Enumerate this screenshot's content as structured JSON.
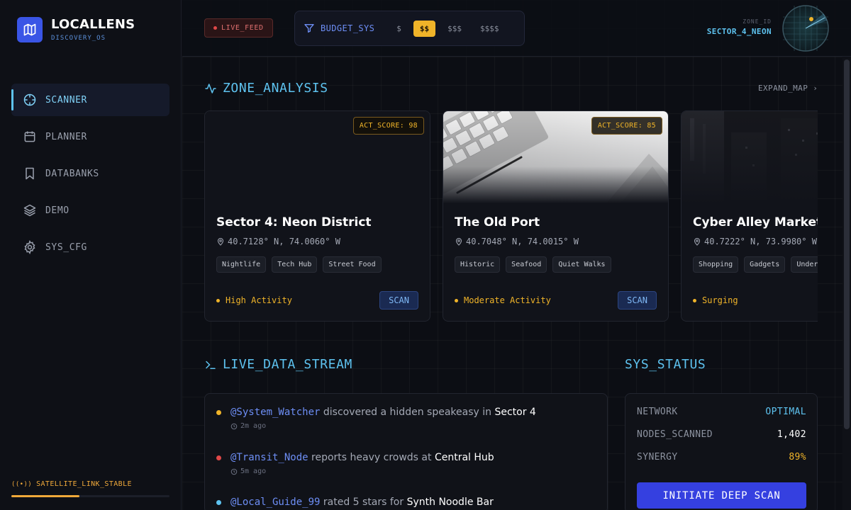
{
  "brand": {
    "name": "LOCALLENS",
    "subtitle": "DISCOVERY_OS"
  },
  "sidebar": {
    "items": [
      {
        "label": "SCANNER",
        "icon": "crosshair-icon",
        "active": true
      },
      {
        "label": "PLANNER",
        "icon": "calendar-icon",
        "active": false
      },
      {
        "label": "DATABANKS",
        "icon": "bookmark-icon",
        "active": false
      },
      {
        "label": "DEMO",
        "icon": "layers-icon",
        "active": false
      },
      {
        "label": "SYS_CFG",
        "icon": "gear-icon",
        "active": false
      }
    ],
    "satellite": {
      "label": "SATELLITE_LINK_STABLE",
      "progress": 0.43
    }
  },
  "topbar": {
    "live_feed": "LIVE_FEED",
    "budget": {
      "label": "BUDGET_SYS",
      "options": [
        "$",
        "$$",
        "$$$",
        "$$$$"
      ],
      "selected": "$$"
    },
    "zone": {
      "label": "ZONE_ID",
      "value": "SECTOR_4_NEON"
    }
  },
  "zone_analysis": {
    "title": "ZONE_ANALYSIS",
    "expand": "EXPAND_MAP",
    "cards": [
      {
        "title": "Sector 4: Neon District",
        "score": "ACT_SCORE: 98",
        "coords": "40.7128° N, 74.0060° W",
        "tags": [
          "Nightlife",
          "Tech Hub",
          "Street Food"
        ],
        "activity": "High Activity",
        "action": "SCAN"
      },
      {
        "title": "The Old Port",
        "score": "ACT_SCORE: 85",
        "coords": "40.7048° N, 74.0015° W",
        "tags": [
          "Historic",
          "Seafood",
          "Quiet Walks"
        ],
        "activity": "Moderate Activity",
        "action": "SCAN"
      },
      {
        "title": "Cyber Alley Market",
        "score": "",
        "coords": "40.7222° N, 73.9980° W",
        "tags": [
          "Shopping",
          "Gadgets",
          "Underground"
        ],
        "activity": "Surging",
        "action": ""
      }
    ]
  },
  "live_stream": {
    "title": "LIVE_DATA_STREAM",
    "items": [
      {
        "user": "@System_Watcher",
        "text": " discovered a hidden speakeasy in ",
        "place": "Sector 4",
        "time": "2m ago",
        "color": "#f0b429"
      },
      {
        "user": "@Transit_Node",
        "text": " reports heavy crowds at ",
        "place": "Central Hub",
        "time": "5m ago",
        "color": "#e04848"
      },
      {
        "user": "@Local_Guide_99",
        "text": " rated 5 stars for ",
        "place": "Synth Noodle Bar",
        "time": "",
        "color": "#5ec3f0"
      }
    ]
  },
  "sys_status": {
    "title": "SYS_STATUS",
    "rows": [
      {
        "key": "NETWORK",
        "value": "OPTIMAL",
        "color": "#5ec3f0"
      },
      {
        "key": "NODES_SCANNED",
        "value": "1,402",
        "color": "#ffffff"
      },
      {
        "key": "SYNERGY",
        "value": "89%",
        "color": "#f0b429"
      }
    ],
    "action": "INITIATE DEEP SCAN"
  },
  "colors": {
    "accent": "#5ec3f0",
    "warning": "#f0b429",
    "primary": "#3540e0",
    "danger": "#e04848"
  }
}
